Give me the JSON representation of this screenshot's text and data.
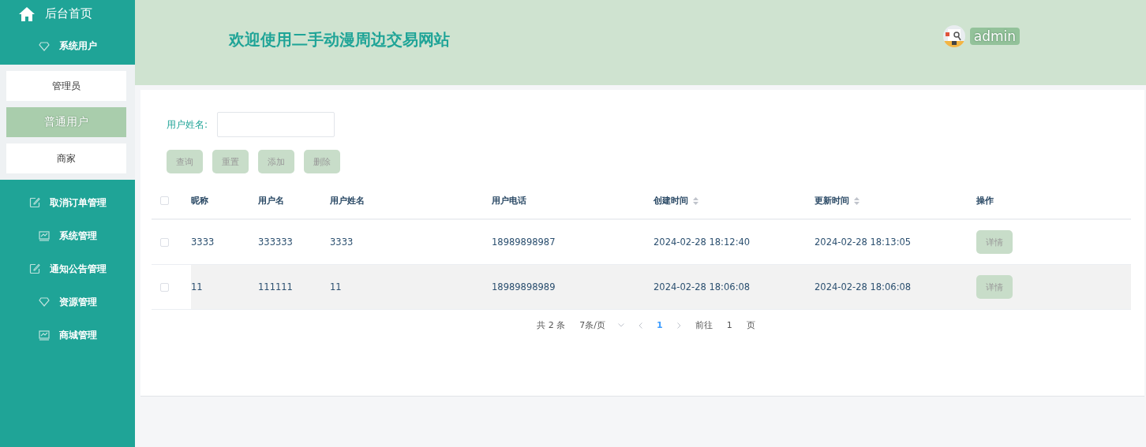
{
  "sidebar": {
    "home": {
      "label": "后台首页"
    },
    "items": [
      {
        "label": "系统用户",
        "kind": "diamond",
        "expanded": true,
        "children": [
          {
            "label": "管理员",
            "selected": false
          },
          {
            "label": "普通用户",
            "selected": true
          },
          {
            "label": "商家",
            "selected": false
          }
        ]
      },
      {
        "label": "取消订单管理",
        "kind": "edit",
        "expanded": false
      },
      {
        "label": "系统管理",
        "kind": "chart",
        "expanded": false
      },
      {
        "label": "通知公告管理",
        "kind": "edit",
        "expanded": false
      },
      {
        "label": "资源管理",
        "kind": "diamond",
        "expanded": false
      },
      {
        "label": "商城管理",
        "kind": "chart",
        "expanded": false
      }
    ]
  },
  "header": {
    "title": "欢迎使用二手动漫周边交易网站",
    "user": "admin"
  },
  "search": {
    "label": "用户姓名:"
  },
  "buttons": [
    "查询",
    "重置",
    "添加",
    "删除"
  ],
  "table": {
    "select_all_checked": false,
    "columns": [
      {
        "label": "昵称",
        "sortable": false
      },
      {
        "label": "用户名",
        "sortable": false
      },
      {
        "label": "用户姓名",
        "sortable": false
      },
      {
        "label": "用户电话",
        "sortable": false
      },
      {
        "label": "创建时间",
        "sortable": true
      },
      {
        "label": "更新时间",
        "sortable": true
      },
      {
        "label": "操作",
        "sortable": false
      }
    ],
    "rows": [
      {
        "checked": false,
        "highlighted": false,
        "cells": [
          "3333",
          "333333",
          "3333",
          "18989898987",
          "2024-02-28 18:12:40",
          "2024-02-28 18:13:05"
        ],
        "action": "详情"
      },
      {
        "checked": false,
        "highlighted": true,
        "cells": [
          "11",
          "111111",
          "11",
          "18989898989",
          "2024-02-28 18:06:08",
          "2024-02-28 18:06:08"
        ],
        "action": "详情"
      }
    ]
  },
  "pagination": {
    "total": "共 2 条",
    "page_size": "7条/页",
    "pages": [
      {
        "label": "1",
        "selected": true
      }
    ],
    "goto_label": "前往",
    "goto_value": "1",
    "goto_suffix": "页"
  }
}
